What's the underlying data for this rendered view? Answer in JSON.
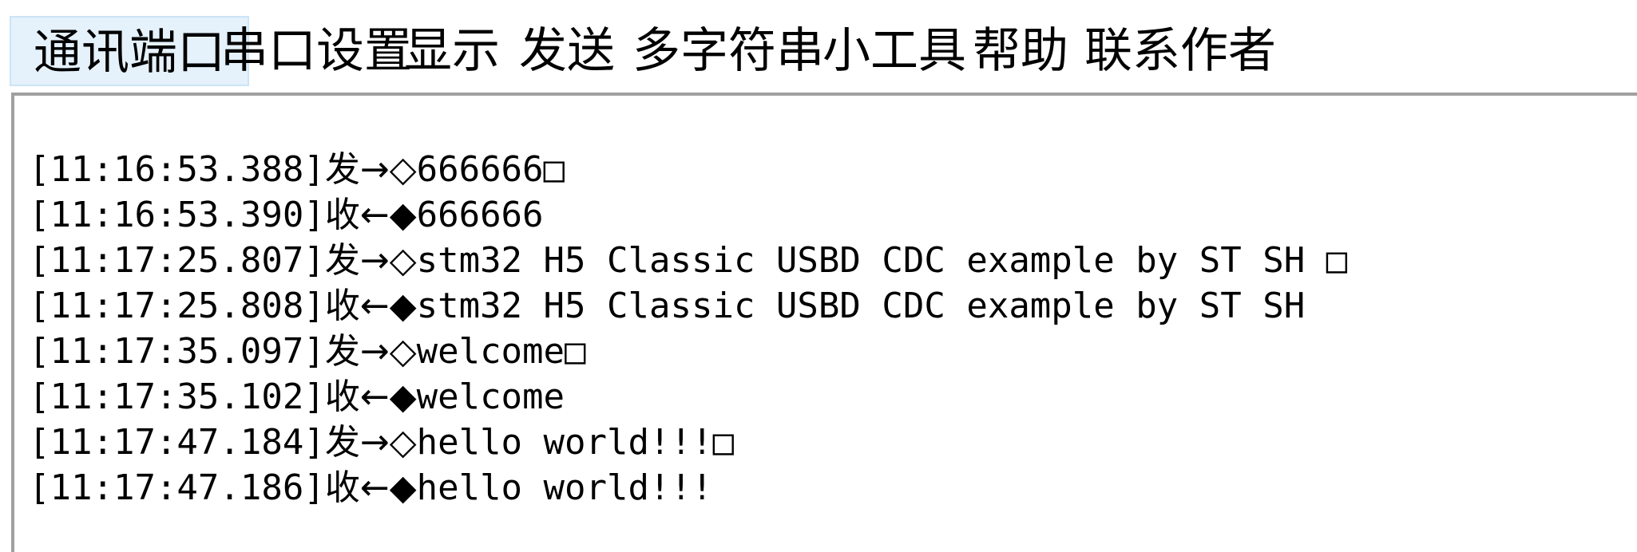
{
  "menu": {
    "items": [
      {
        "label": "通讯端口",
        "active": true
      },
      {
        "label": "串口设置",
        "active": false
      },
      {
        "label": "显示",
        "active": false
      },
      {
        "label": "发送",
        "active": false
      },
      {
        "label": "多字符串",
        "active": false
      },
      {
        "label": "小工具",
        "active": false
      },
      {
        "label": "帮助",
        "active": false
      },
      {
        "label": "联系作者",
        "active": false
      }
    ]
  },
  "log": {
    "lines": [
      {
        "time": "[11:16:53.388]",
        "dir": "发→◇",
        "text": "666666□"
      },
      {
        "time": "[11:16:53.390]",
        "dir": "收←◆",
        "text": "666666"
      },
      {
        "time": "[11:17:25.807]",
        "dir": "发→◇",
        "text": "stm32 H5 Classic USBD CDC example by ST SH □"
      },
      {
        "time": "[11:17:25.808]",
        "dir": "收←◆",
        "text": "stm32 H5 Classic USBD CDC example by ST SH"
      },
      {
        "time": "[11:17:35.097]",
        "dir": "发→◇",
        "text": "welcome□"
      },
      {
        "time": "[11:17:35.102]",
        "dir": "收←◆",
        "text": "welcome"
      },
      {
        "time": "[11:17:47.184]",
        "dir": "发→◇",
        "text": "hello world!!!□"
      },
      {
        "time": "[11:17:47.186]",
        "dir": "收←◆",
        "text": "hello world!!!"
      }
    ]
  }
}
